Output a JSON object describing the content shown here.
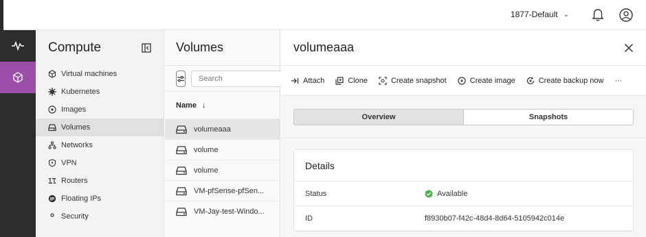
{
  "topbar": {
    "project": "1877-Default"
  },
  "sidebar": {
    "title": "Compute",
    "items": [
      {
        "label": "Virtual machines",
        "icon": "cube-icon"
      },
      {
        "label": "Kubernetes",
        "icon": "helm-icon"
      },
      {
        "label": "Images",
        "icon": "disc-icon"
      },
      {
        "label": "Volumes",
        "icon": "drive-icon",
        "active": true
      },
      {
        "label": "Networks",
        "icon": "network-icon"
      },
      {
        "label": "VPN",
        "icon": "shield-icon"
      },
      {
        "label": "Routers",
        "icon": "router-icon"
      },
      {
        "label": "Floating IPs",
        "icon": "ip-icon"
      },
      {
        "label": "Security",
        "icon": "security-icon"
      }
    ]
  },
  "list": {
    "title": "Volumes",
    "search_placeholder": "Search",
    "column": "Name",
    "sort_indicator": "↓",
    "rows": [
      "volumeaaa",
      "volume",
      "volume",
      "VM-pfSense-pfSen...",
      "VM-Jay-test-Windo..."
    ]
  },
  "detail": {
    "title": "volumeaaa",
    "actions": [
      {
        "label": "Attach",
        "icon": "attach-icon"
      },
      {
        "label": "Clone",
        "icon": "clone-icon"
      },
      {
        "label": "Create snapshot",
        "icon": "snapshot-icon"
      },
      {
        "label": "Create image",
        "icon": "image-icon"
      },
      {
        "label": "Create backup now",
        "icon": "backup-icon"
      }
    ],
    "more": "···",
    "tabs": [
      "Overview",
      "Snapshots"
    ],
    "card_title": "Details",
    "fields": [
      {
        "key": "Status",
        "value": "Available"
      },
      {
        "key": "ID",
        "value": "f8930b07-f42c-48d4-8d64-5105942c014e"
      }
    ]
  },
  "colors": {
    "accent": "#9c4fa8",
    "rail": "#2d2d2d",
    "status_ok": "#4caf50"
  }
}
